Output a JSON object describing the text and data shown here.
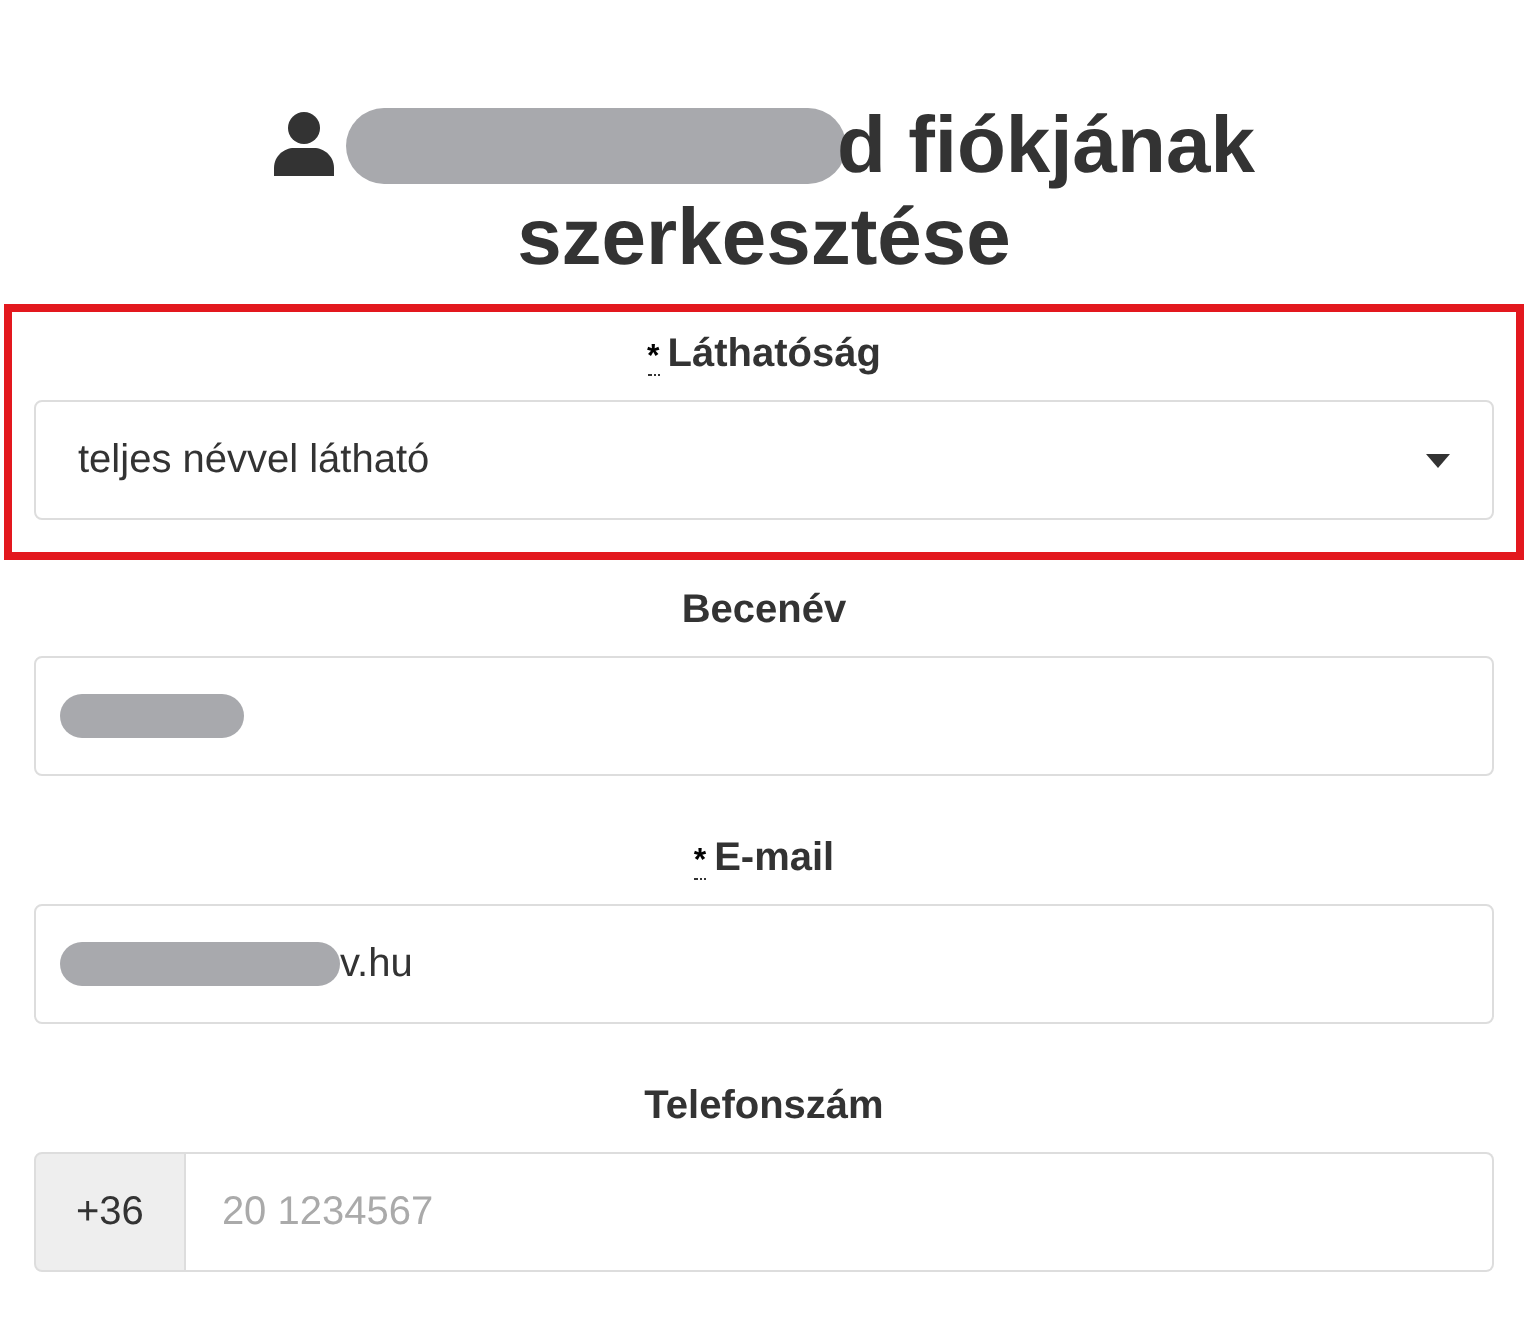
{
  "heading": {
    "text": "d fiókjának szerkesztése",
    "redacted": true
  },
  "fields": [
    {
      "kind": "select",
      "label": "Láthatóság",
      "required_mark": "*",
      "value": "teljes névvel látható",
      "highlighted": true
    },
    {
      "kind": "text",
      "label": "Becenév",
      "redacted": true
    },
    {
      "kind": "text",
      "label": "E-mail",
      "required_mark": "*",
      "value": "v.hu",
      "redacted": true
    },
    {
      "kind": "phone",
      "label": "Telefonszám",
      "prefix": "+36",
      "placeholder": "20 1234567"
    }
  ]
}
